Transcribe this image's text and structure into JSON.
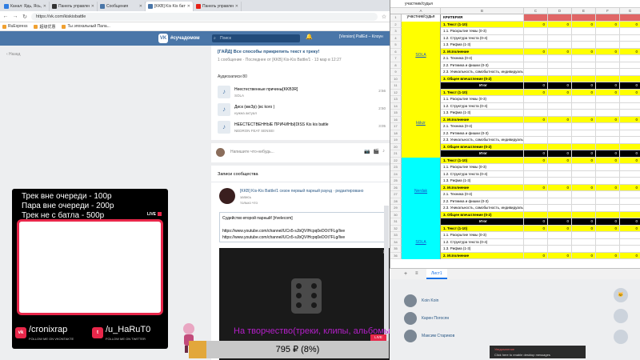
{
  "browser": {
    "tabs": [
      {
        "label": "Канал: Ядь, Ясь, Ласкаю (б)",
        "color": "#2f7de1",
        "active": false
      },
      {
        "label": "Панель управления · Экосистема",
        "color": "#333333",
        "active": false
      },
      {
        "label": "Сообщения",
        "color": "#4a76a8",
        "active": false
      },
      {
        "label": "[KKB] Kis Kis баттл из второго...",
        "color": "#4a76a8",
        "active": true
      },
      {
        "label": "Панель управления трансля...",
        "color": "#e62117",
        "active": false
      }
    ],
    "url": "https://vk.com/kiskisbattle",
    "bookmarks": [
      "RuExpress",
      "超级优惠",
      "Ты эпохальный Пала..."
    ]
  },
  "vk_header": {
    "logo_letter": "VK",
    "brand": "#сучадомом",
    "search_placeholder": "Поиск",
    "now_playing": "[Version] PallEd – Клоун"
  },
  "back_link": "‹ Назад",
  "pinned": {
    "title": "[ГАЙД] Все способы прикрепить текст к треку!",
    "meta": "1 сообщение · Последнее от [KKB] Kis-Kis Battle/1 · 13 мар в 12:27"
  },
  "audio": {
    "heading": "Аудиозаписи 80",
    "tracks": [
      {
        "title": "Неестественные причины[KKB3R]",
        "artist": "SOLA",
        "duration": "2:56"
      },
      {
        "title": "Диск (кккЗр) (вс koro )",
        "artist": "нужна актуал",
        "duration": "2:50"
      },
      {
        "title": "НЕЕСТЕСТВЕННЫЕ ПРИЧИНЫ|DISS Kis kis battle",
        "artist": "NEDRON FEAT SENSEI",
        "duration": "3:05"
      }
    ]
  },
  "comment": {
    "placeholder": "Напишите что-нибудь..."
  },
  "wall": {
    "tab": "Записи сообщества",
    "post_title": "[KKB] Kis-Kis Battle/1 сезон первый парный раунд · редактировано",
    "post_sub": "запись",
    "post_time": "только что",
    "lines": [
      "Судейство второй парный! [#velecom]",
      "",
      "https://www.youtube.com/channel/UCn5-sJbQVIHcpq0eDOt7FLg/live",
      "https://www.youtube.com/channel/UCn5-sJbQVIHcpq0eDOt7FLg/live"
    ],
    "video_close": "✕"
  },
  "overlay": {
    "queue": [
      "Трек вне очереди - 100р",
      "Пара вне очереди - 200р",
      "Трек не с батла - 500р"
    ],
    "live": "LIVE",
    "vk_handle": "/cronixrap",
    "vk_follow": "FOLLOW ME ON VKONTAKTE",
    "tw_handle": "/u_HaRuT0",
    "tw_follow": "FOLLOW ME ON TWITTER",
    "creative": "На творчество(треки, клипы, альбомы)",
    "donation": "795 ₽ (8%)",
    "live_small": "LIVE"
  },
  "sheet": {
    "formula": "участник/судья",
    "headers": {
      "participant": "участник/судья",
      "criteria": "КРИТЕРИЯ"
    },
    "col_letters": [
      "A",
      "B",
      "C",
      "D",
      "E",
      "F",
      "G"
    ],
    "participants": [
      "SOLA",
      "kkkzr",
      "Nerdak",
      "SOLA"
    ],
    "tab_label": "Лист1",
    "rows": [
      {
        "n": "1",
        "type": "header",
        "crit": "КРИТЕРИЯ"
      },
      {
        "n": "2",
        "type": "section",
        "crit": "1. Текст (1-10)",
        "vals": [
          "0",
          "0",
          "0",
          "0",
          "0"
        ]
      },
      {
        "n": "3",
        "type": "item",
        "crit": "1.1. Раскрытие темы (0-3)"
      },
      {
        "n": "4",
        "type": "item",
        "crit": "1.2. Структура текста (0-4)"
      },
      {
        "n": "5",
        "type": "item",
        "crit": "1.3. Рифма (1-3)"
      },
      {
        "n": "6",
        "type": "section",
        "crit": "2. Исполнение",
        "vals": [
          "0",
          "0",
          "0",
          "0",
          "0"
        ]
      },
      {
        "n": "7",
        "type": "item",
        "crit": "2.1. Техника (0-4)"
      },
      {
        "n": "8",
        "type": "item",
        "crit": "2.2. Ритмика и фишки (0-3)"
      },
      {
        "n": "9",
        "type": "item",
        "crit": "2.3. Уникальность, самобытность, индивидуальность (0-3)"
      },
      {
        "n": "10",
        "type": "section",
        "crit": "3. Общее впечатление (0-2)"
      },
      {
        "n": "11",
        "type": "total",
        "crit": "Итог",
        "vals": [
          "0",
          "0",
          "0",
          "0",
          "0"
        ]
      },
      {
        "n": "12",
        "type": "section",
        "crit": "1. Текст (1-10)",
        "vals": [
          "0",
          "0",
          "0",
          "0",
          "0"
        ]
      },
      {
        "n": "13",
        "type": "item",
        "crit": "1.1. Раскрытие темы (0-3)"
      },
      {
        "n": "14",
        "type": "item",
        "crit": "1.2. Структура текста (0-4)"
      },
      {
        "n": "15",
        "type": "item",
        "crit": "1.3. Рифма (1-3)"
      },
      {
        "n": "16",
        "type": "section",
        "crit": "2. Исполнение",
        "vals": [
          "0",
          "0",
          "0",
          "0",
          "0"
        ]
      },
      {
        "n": "17",
        "type": "item",
        "crit": "2.1. Техника (0-4)"
      },
      {
        "n": "18",
        "type": "item",
        "crit": "2.2. Ритмика и фишки (0-3)"
      },
      {
        "n": "19",
        "type": "item",
        "crit": "2.3. Уникальность, самобытность, индивидуальность (0-3)"
      },
      {
        "n": "20",
        "type": "section",
        "crit": "3. Общее впечатление (0-2)"
      },
      {
        "n": "21",
        "type": "total",
        "crit": "Итог",
        "vals": [
          "0",
          "0",
          "0",
          "0",
          "0"
        ]
      },
      {
        "n": "22",
        "type": "section",
        "crit": "1. Текст (1-10)",
        "vals": [
          "0",
          "0",
          "0",
          "0",
          "0"
        ]
      },
      {
        "n": "23",
        "type": "item",
        "crit": "1.1. Раскрытие темы (0-3)"
      },
      {
        "n": "24",
        "type": "item",
        "crit": "1.2. Структура текста (0-4)"
      },
      {
        "n": "25",
        "type": "item",
        "crit": "1.3. Рифма (1-3)"
      },
      {
        "n": "26",
        "type": "section",
        "crit": "2. Исполнение",
        "vals": [
          "0",
          "0",
          "0",
          "0",
          "0"
        ]
      },
      {
        "n": "27",
        "type": "item",
        "crit": "2.1. Техника (0-4)"
      },
      {
        "n": "28",
        "type": "item",
        "crit": "2.2. Ритмика и фишки (0-3)"
      },
      {
        "n": "29",
        "type": "item",
        "crit": "2.3. Уникальность, самобытность, индивидуальность (0-3)"
      },
      {
        "n": "30",
        "type": "section",
        "crit": "3. Общее впечатление (0-2)"
      },
      {
        "n": "31",
        "type": "total",
        "crit": "Итог",
        "vals": [
          "0",
          "0",
          "0",
          "0",
          "0"
        ]
      },
      {
        "n": "32",
        "type": "section",
        "crit": "1. Текст (1-10)",
        "vals": [
          "0",
          "0",
          "0",
          "0",
          "0"
        ]
      },
      {
        "n": "33",
        "type": "item",
        "crit": "1.1. Раскрытие темы (0-3)"
      },
      {
        "n": "34",
        "type": "item",
        "crit": "1.2. Структура текста (0-4)"
      },
      {
        "n": "35",
        "type": "item",
        "crit": "1.3. Рифма (1-3)"
      },
      {
        "n": "36",
        "type": "section",
        "crit": "2. Исполнение",
        "vals": [
          "0",
          "0",
          "0",
          "0",
          "0"
        ]
      }
    ],
    "colors": {
      "yellow": "#ffff00",
      "cyan": "#00ffff",
      "black": "#000000",
      "header_red": "#e06666"
    }
  },
  "friends": [
    {
      "name": "Koin Koin"
    },
    {
      "name": "Карен Погосян"
    },
    {
      "name": "Максим Стариков"
    }
  ],
  "notification": {
    "title": "Уведомление",
    "text": "Click here to enable desktop messages"
  }
}
